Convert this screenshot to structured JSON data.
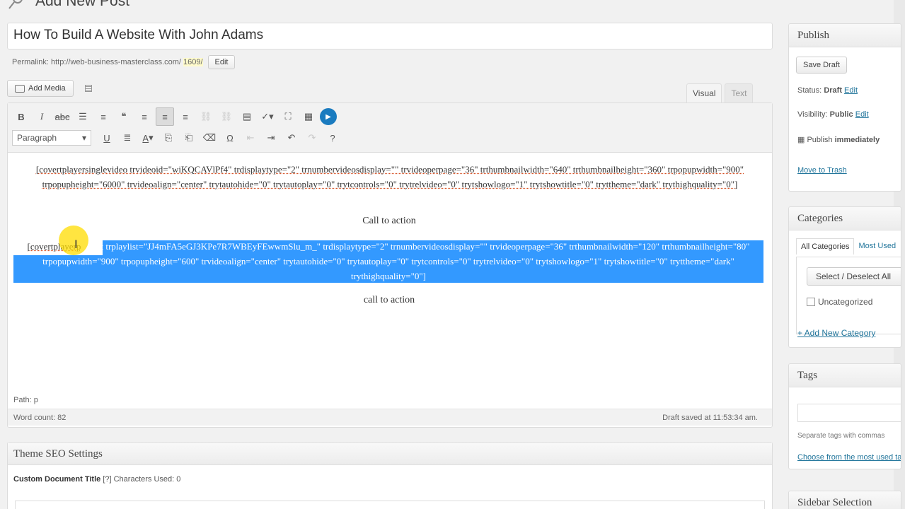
{
  "page": {
    "heading": "Add New Post"
  },
  "post": {
    "title": "How To Build A Website With John Adams",
    "permalink_label": "Permalink:",
    "permalink_url": "http://web-business-masterclass.com/",
    "permalink_slug": "1609/",
    "permalink_edit": "Edit"
  },
  "media": {
    "add_media_label": "Add Media"
  },
  "tabs": {
    "visual": "Visual",
    "text": "Text"
  },
  "toolbar": {
    "format_select": "Paragraph",
    "row1_icons": [
      "bold-icon",
      "italic-icon",
      "strikethrough-icon",
      "bullet-list-icon",
      "numbered-list-icon",
      "blockquote-icon",
      "align-left-icon",
      "align-center-icon",
      "align-right-icon",
      "insert-link-icon",
      "remove-link-icon",
      "insert-more-icon",
      "spellcheck-icon",
      "fullscreen-icon",
      "toolbar-toggle-icon",
      "play-icon"
    ],
    "row2_icons": [
      "underline-icon",
      "justify-icon",
      "text-color-icon",
      "paste-text-icon",
      "paste-word-icon",
      "clear-format-icon",
      "special-char-icon",
      "outdent-icon",
      "indent-icon",
      "undo-icon",
      "redo-icon",
      "help-icon"
    ]
  },
  "content": {
    "shortcode1": "[covertplayersinglevideo trvideoid=\"wiKQCAVlPf4\" trdisplaytype=\"2\" trnumbervideosdisplay=\"\" trvideoperpage=\"36\" trthumbnailwidth=\"640\" trthumbnailheight=\"360\" trpopupwidth=\"900\" trpopupheight=\"6000\" trvideoalign=\"center\" trytautohide=\"0\" trytautoplay=\"0\" trytcontrols=\"0\" trytrelvideo=\"0\" trytshowlogo=\"1\" trytshowtitle=\"0\" tryttheme=\"dark\" trythighquality=\"0\"]",
    "cta1": "Call to action",
    "shortcode2_unselected": "[covertplayerp",
    "shortcode2_selected": "laylist trplaylist=\"JJ4mFA5eGJ3KPe7R7WBEyFEwwmSlu_m_\" trdisplaytype=\"2\" trnumbervideosdisplay=\"\" trvideoperpage=\"36\" trthumbnailwidth=\"120\" trthumbnailheight=\"80\" trpopupwidth=\"900\" trpopupheight=\"600\" trvideoalign=\"center\" trytautohide=\"0\" trytautoplay=\"0\" trytcontrols=\"0\" trytrelvideo=\"0\" trytshowlogo=\"1\" trytshowtitle=\"0\" tryttheme=\"dark\" trythighquality=\"0\"]",
    "cta2": "call to action"
  },
  "status": {
    "path": "Path: p",
    "word_count": "Word count: 82",
    "draft_saved": "Draft saved at 11:53:34 am."
  },
  "seo": {
    "heading": "Theme SEO Settings",
    "field_label": "Custom Document Title",
    "field_help": "[?] Characters Used: 0"
  },
  "publish": {
    "heading": "Publish",
    "save_draft": "Save Draft",
    "status_label": "Status:",
    "status_value": "Draft",
    "status_edit": "Edit",
    "visibility_label": "Visibility:",
    "visibility_value": "Public",
    "visibility_edit": "Edit",
    "publish_label": "Publish",
    "publish_value": "immediately",
    "trash": "Move to Trash"
  },
  "categories": {
    "heading": "Categories",
    "tab_all": "All Categories",
    "tab_most": "Most Used",
    "select_button": "Select / Deselect All",
    "item": "Uncategorized",
    "add_new": "+ Add New Category"
  },
  "tags": {
    "heading": "Tags",
    "hint": "Separate tags with commas",
    "choose": "Choose from the most used tags"
  },
  "sidebar_selection": {
    "heading": "Sidebar Selection"
  }
}
